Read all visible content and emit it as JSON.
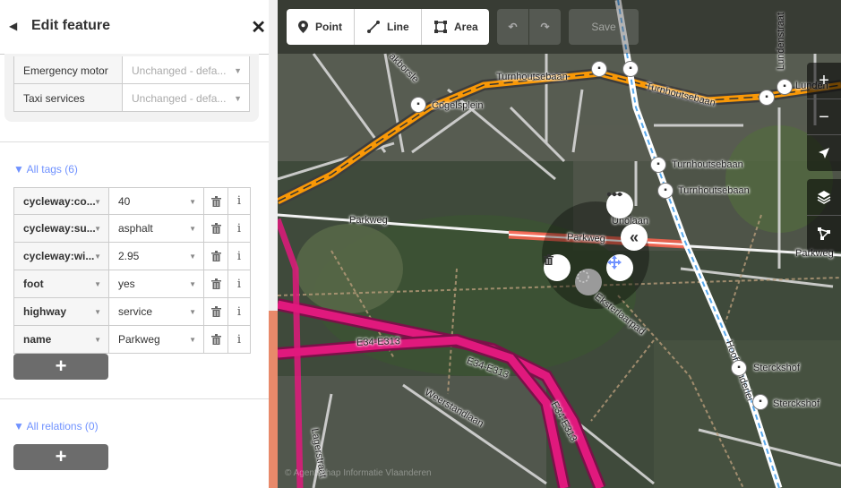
{
  "sidebar": {
    "back_icon": "◀",
    "title": "Edit feature",
    "close_icon": "✕",
    "fields": [
      {
        "label": "Emergency motor",
        "value": "Unchanged - defa..."
      },
      {
        "label": "Taxi services",
        "value": "Unchanged - defa..."
      }
    ],
    "tags_heading": "All tags (6)",
    "tags": [
      {
        "key": "cycleway:co...",
        "value": "40"
      },
      {
        "key": "cycleway:su...",
        "value": "asphalt"
      },
      {
        "key": "cycleway:wi...",
        "value": "2.95"
      },
      {
        "key": "foot",
        "value": "yes"
      },
      {
        "key": "highway",
        "value": "service"
      },
      {
        "key": "name",
        "value": "Parkweg"
      }
    ],
    "add_label": "+",
    "relations_heading": "All relations (0)",
    "info_glyph": "i"
  },
  "toolbar": {
    "point_label": "Point",
    "line_label": "Line",
    "area_label": "Area",
    "save_label": "Save"
  },
  "map_controls": {
    "zoom_in": "+",
    "zoom_out": "−"
  },
  "map_labels": {
    "turnhoutsebaan": "Turnhoutsebaan",
    "turnhoutsebaan_right": "Turnhoutsebaan",
    "lunden": "Lunden",
    "lundenstraat": "Lundenstraat",
    "cogelsplein": "Cogelsplein",
    "stop_turnhoutsebaan_1": "Turnhoutsebaan",
    "stop_turnhoutsebaan_2": "Turnhoutsebaan",
    "parkweg_left": "Parkweg",
    "parkweg_selected": "Parkweg",
    "parkweg_right": "Parkweg",
    "unolaan": "Unolaan",
    "ekster": "Eksterlaarpad",
    "e34_1": "E34-E313",
    "e34_2": "E34-E313",
    "e34_3": "E34-E313",
    "weerstandlaan": "Weerstandlaan",
    "hooftvunderlei": "Hooftvunderlei",
    "sterckshof_1": "Sterckshof",
    "sterckshof_2": "Sterckshof",
    "borsbeek": "akborsle",
    "lagerstraat": "Lagerstraat"
  },
  "attribution": "© Agentschap Informatie Vlaanderen",
  "colors": {
    "accent": "#7092ff",
    "scroll_thumb": "#e8896a",
    "motorway": "#e0197d",
    "primary": "#f99806",
    "selected": "#f6634f"
  }
}
